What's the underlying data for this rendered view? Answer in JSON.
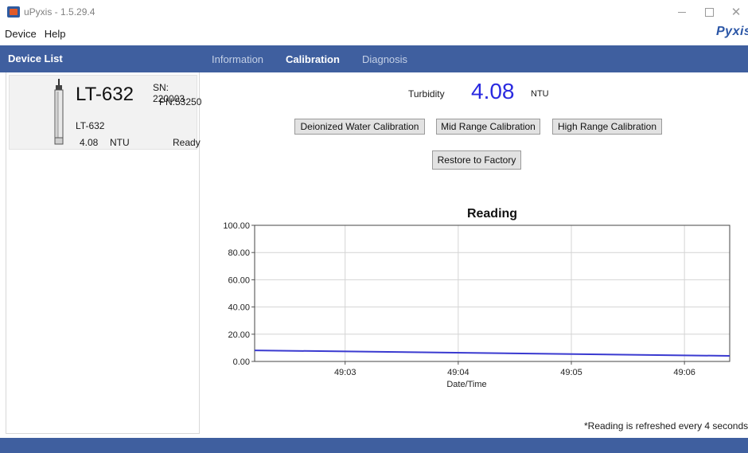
{
  "window": {
    "title": "uPyxis - 1.5.29.4"
  },
  "menu": {
    "items": [
      "Device",
      "Help"
    ],
    "brand": "Pyxis"
  },
  "sidebar": {
    "title": "Device List",
    "device": {
      "name": "LT-632",
      "sn": "SN: 220003",
      "pn": "PN:53250",
      "model": "LT-632",
      "reading": "4.08",
      "unit": "NTU",
      "status": "Ready"
    }
  },
  "tabs": [
    {
      "label": "Information",
      "active": false
    },
    {
      "label": "Calibration",
      "active": true
    },
    {
      "label": "Diagnosis",
      "active": false
    }
  ],
  "calibration": {
    "turbidity_label": "Turbidity",
    "turbidity_value": "4.08",
    "turbidity_unit": "NTU",
    "buttons": {
      "deionized": "Deionized Water Calibration",
      "mid": "Mid Range Calibration",
      "high": "High Range Calibration",
      "restore": "Restore to Factory"
    },
    "refresh_note": "*Reading is refreshed every 4 seconds"
  },
  "colors": {
    "header_band": "#3f5f9f",
    "line": "#3a3ad0",
    "value_text": "#2a2ae0"
  },
  "chart_data": {
    "type": "line",
    "title": "Reading",
    "xlabel": "Date/Time",
    "ylabel": "",
    "ylim": [
      0,
      100
    ],
    "yticks": [
      "0.00",
      "20.00",
      "40.00",
      "60.00",
      "80.00",
      "100.00"
    ],
    "xticks": [
      "49:03",
      "49:04",
      "49:05",
      "49:06"
    ],
    "grid": true,
    "series": [
      {
        "x": [
          "49:02.2",
          "49:06.4"
        ],
        "values": [
          8.1,
          4.1
        ]
      }
    ]
  }
}
